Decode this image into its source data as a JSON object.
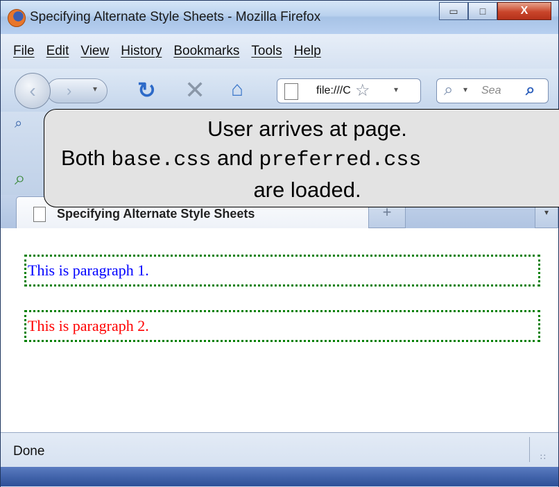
{
  "window": {
    "title": "Specifying Alternate Style Sheets - Mozilla Firefox",
    "controls": {
      "minimize": "▭",
      "maximize": "□",
      "close": "X"
    }
  },
  "menu": [
    "File",
    "Edit",
    "View",
    "History",
    "Bookmarks",
    "Tools",
    "Help"
  ],
  "nav": {
    "back_icon": "back-arrow-icon",
    "forward_icon": "forward-arrow-icon",
    "url": "file:///C:/",
    "search_placeholder": "Sea"
  },
  "tab": {
    "title": "Specifying Alternate Style Sheets",
    "new_tab_label": "+",
    "list_label": "▾"
  },
  "content": {
    "paragraph1": "This is paragraph 1.",
    "paragraph2": "This is paragraph 2.",
    "paragraph1_color": "#0000ff",
    "paragraph2_color": "#ff0000",
    "border_color": "#008000"
  },
  "status": {
    "text": "Done"
  },
  "callout": {
    "line1": "User arrives at page.",
    "line2_prefix": "Both ",
    "line2_file1": "base.css",
    "line2_mid": " and ",
    "line2_file2": "preferred.css",
    "line3": "are loaded."
  }
}
